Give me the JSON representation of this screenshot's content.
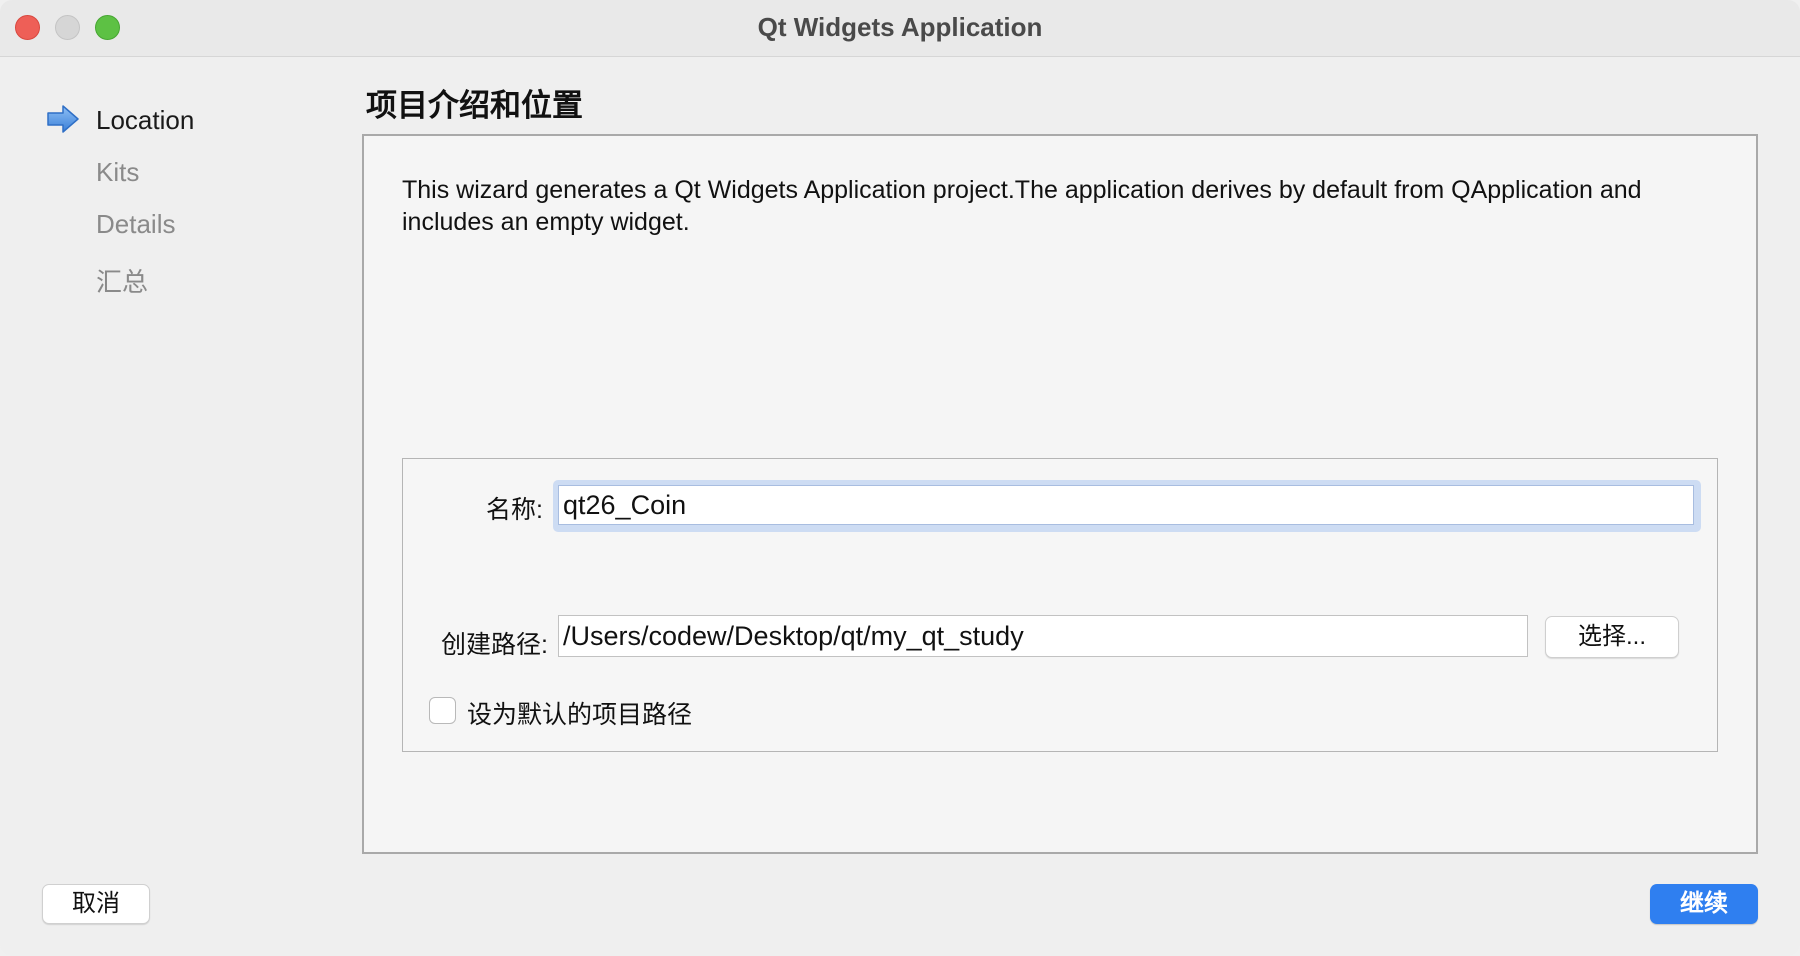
{
  "window": {
    "title": "Qt Widgets Application"
  },
  "sidebar": {
    "steps": [
      {
        "label": "Location",
        "active": true
      },
      {
        "label": "Kits",
        "active": false
      },
      {
        "label": "Details",
        "active": false
      },
      {
        "label": "汇总",
        "active": false
      }
    ],
    "active_icon": "arrow-right-icon"
  },
  "main": {
    "page_title": "项目介绍和位置",
    "intro_text": "This wizard generates a Qt Widgets Application project.The application derives by default from QApplication and includes an empty widget.",
    "name_label": "名称:",
    "name_value": "qt26_Coin",
    "path_label": "创建路径:",
    "path_value": "/Users/codew/Desktop/qt/my_qt_study",
    "choose_button": "选择...",
    "default_path_checkbox": {
      "label": "设为默认的项目路径",
      "checked": false
    }
  },
  "footer": {
    "cancel_label": "取消",
    "continue_label": "继续"
  },
  "colors": {
    "accent": "#2f7ff0",
    "arrow": "#4a8fe0",
    "close": "#ee5f57",
    "maximize": "#5dc144"
  }
}
